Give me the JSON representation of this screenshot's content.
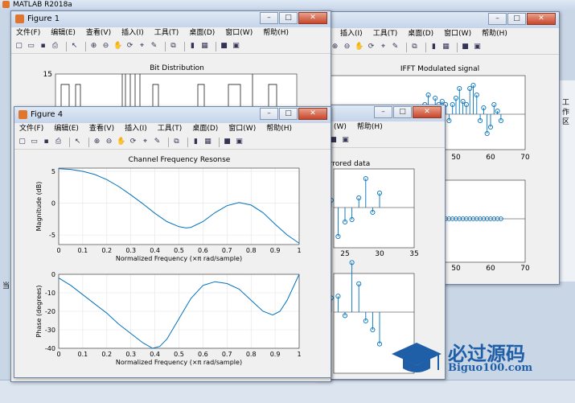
{
  "matlab": {
    "title": "MATLAB R2018a",
    "right_panel_label": "工作区",
    "left_tab_label": "当"
  },
  "menu": [
    "文件(F)",
    "编辑(E)",
    "查看(V)",
    "插入(I)",
    "工具(T)",
    "桌面(D)",
    "窗口(W)",
    "帮助(H)"
  ],
  "figure1": {
    "title": "Figure 1",
    "plot_title": "Bit Distribution",
    "y_top_tick": "15"
  },
  "figure2": {
    "menu_visible": [
      "插入(I)",
      "工具(T)",
      "桌面(D)",
      "窗口(W)",
      "帮助(H)"
    ],
    "plot_title": "IFFT Modulated signal",
    "xticks_top": [
      "50",
      "60",
      "70"
    ],
    "xticks_mid": [
      "50",
      "60",
      "70"
    ]
  },
  "figure3": {
    "menu_visible": [
      "(W)",
      "帮助(H)"
    ],
    "plot_title": "rrored data",
    "xticks": [
      "25",
      "30",
      "35"
    ]
  },
  "figure4": {
    "title": "Figure 4",
    "plot_title": "Channel Frequency Resonse"
  },
  "chart_data": [
    {
      "type": "line",
      "title": "Channel Frequency Resonse",
      "xlabel": "Normalized Frequency  (×π rad/sample)",
      "ylabel": "Magnitude (dB)",
      "xlim": [
        0,
        1
      ],
      "ylim": [
        -6.5,
        5.5
      ],
      "xticks": [
        0,
        0.1,
        0.2,
        0.3,
        0.4,
        0.5,
        0.6,
        0.7,
        0.8,
        0.9,
        1
      ],
      "yticks": [
        5,
        0,
        -5
      ],
      "grid": true,
      "x": [
        0,
        0.05,
        0.1,
        0.15,
        0.2,
        0.25,
        0.3,
        0.35,
        0.4,
        0.45,
        0.5,
        0.53,
        0.55,
        0.6,
        0.65,
        0.7,
        0.75,
        0.8,
        0.85,
        0.9,
        0.95,
        1
      ],
      "y": [
        5.4,
        5.3,
        5.0,
        4.5,
        3.7,
        2.6,
        1.3,
        -0.1,
        -1.6,
        -2.9,
        -3.7,
        -3.9,
        -3.8,
        -2.9,
        -1.5,
        -0.4,
        0.1,
        -0.3,
        -1.5,
        -3.3,
        -5.0,
        -6.3
      ]
    },
    {
      "type": "line",
      "xlabel": "Normalized Frequency  (×π rad/sample)",
      "ylabel": "Phase (degrees)",
      "xlim": [
        0,
        1
      ],
      "ylim": [
        -40,
        0
      ],
      "xticks": [
        0,
        0.1,
        0.2,
        0.3,
        0.4,
        0.5,
        0.6,
        0.7,
        0.8,
        0.9,
        1
      ],
      "yticks": [
        0,
        -10,
        -20,
        -30,
        -40
      ],
      "grid": true,
      "x": [
        0,
        0.05,
        0.1,
        0.15,
        0.2,
        0.25,
        0.3,
        0.35,
        0.39,
        0.42,
        0.45,
        0.5,
        0.55,
        0.6,
        0.65,
        0.7,
        0.75,
        0.8,
        0.85,
        0.89,
        0.92,
        0.95,
        1
      ],
      "y": [
        -2,
        -6,
        -11,
        -16,
        -21,
        -27,
        -32,
        -37,
        -40,
        -39,
        -35,
        -24,
        -13,
        -6,
        -4,
        -5,
        -8,
        -14,
        -20,
        -22,
        -20,
        -14,
        0
      ]
    },
    {
      "type": "scatter",
      "title": "IFFT Modulated signal",
      "xlim": [
        20,
        70
      ],
      "xticks": [
        50,
        60,
        70
      ],
      "x": [
        41,
        42,
        43,
        44,
        45,
        46,
        47,
        48,
        49,
        50,
        51,
        52,
        53,
        54,
        55,
        56,
        57,
        58,
        59,
        60,
        61,
        62,
        63
      ],
      "y": [
        0.3,
        0.6,
        0.2,
        0.5,
        0.3,
        0.4,
        0.3,
        -0.2,
        0.3,
        0.5,
        0.8,
        0.4,
        0.3,
        0.8,
        0.9,
        0.6,
        -0.2,
        0.2,
        -0.6,
        -0.4,
        0.3,
        0.1,
        -0.2
      ]
    },
    {
      "type": "scatter",
      "title": "rrored data",
      "xlim": [
        20,
        35
      ],
      "xticks": [
        25,
        30,
        35
      ],
      "x": [
        23,
        24,
        25,
        26,
        27,
        28,
        29,
        30
      ],
      "y": [
        0.3,
        -1.2,
        -0.6,
        -0.5,
        0.4,
        1.2,
        -0.2,
        0.6
      ]
    }
  ]
}
